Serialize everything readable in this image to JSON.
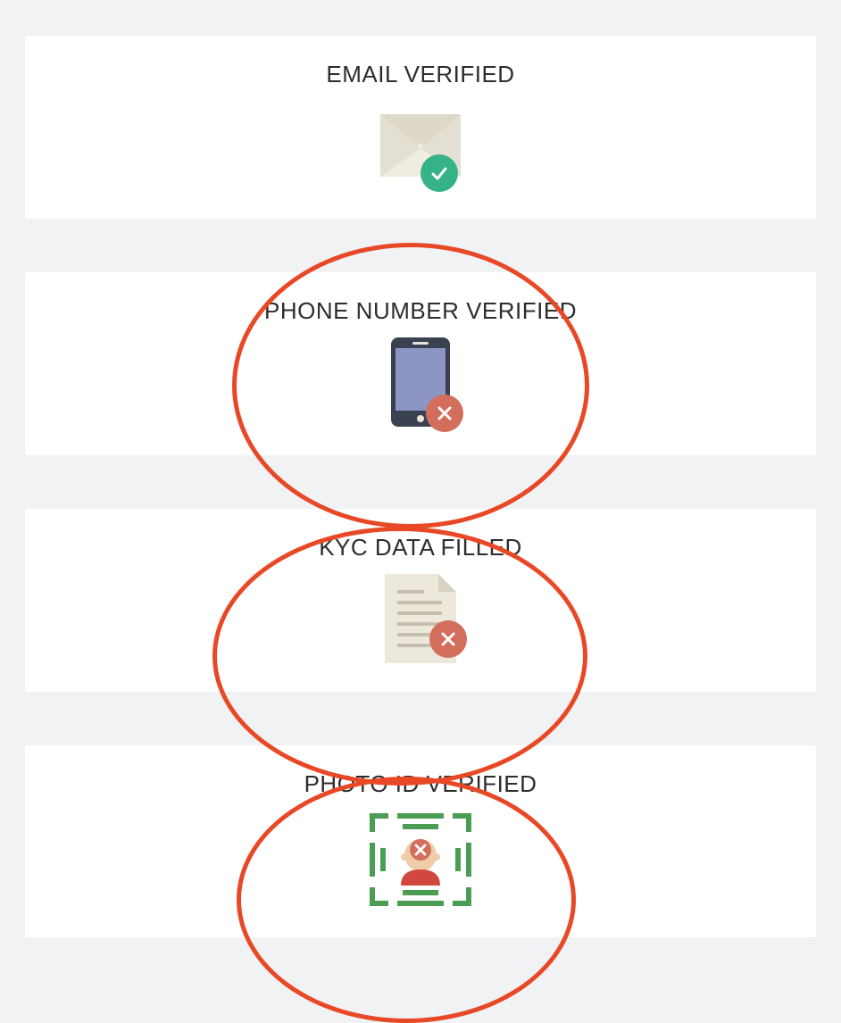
{
  "cards": [
    {
      "title": "EMAIL VERIFIED",
      "status": "success"
    },
    {
      "title": "PHONE NUMBER VERIFIED",
      "status": "fail"
    },
    {
      "title": "KYC DATA FILLED",
      "status": "fail"
    },
    {
      "title": "PHOTO ID VERIFIED",
      "status": "fail"
    }
  ]
}
